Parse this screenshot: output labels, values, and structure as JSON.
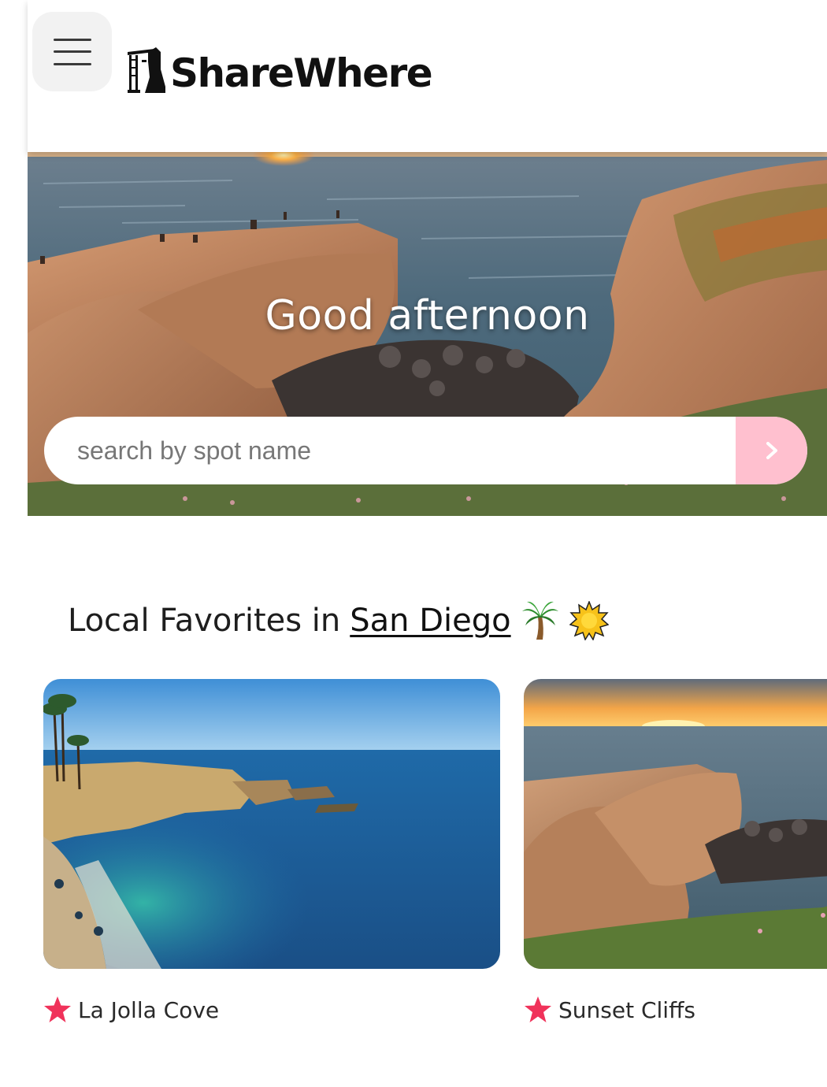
{
  "header": {
    "brand_name": "ShareWhere"
  },
  "hero": {
    "greeting": "Good afternoon",
    "search": {
      "placeholder": "search by spot name",
      "value": ""
    }
  },
  "favorites": {
    "heading_prefix": "Local Favorites in",
    "city": "San Diego",
    "emojis": [
      "palm-tree",
      "sun"
    ],
    "spots": [
      {
        "name": "La Jolla Cove",
        "icon": "star-icon"
      },
      {
        "name": "Sunset Cliffs",
        "icon": "star-icon"
      }
    ]
  },
  "colors": {
    "accent_pink": "#ffc0cf",
    "star_red": "#f0325a",
    "text_dark": "#1e1e1e"
  }
}
